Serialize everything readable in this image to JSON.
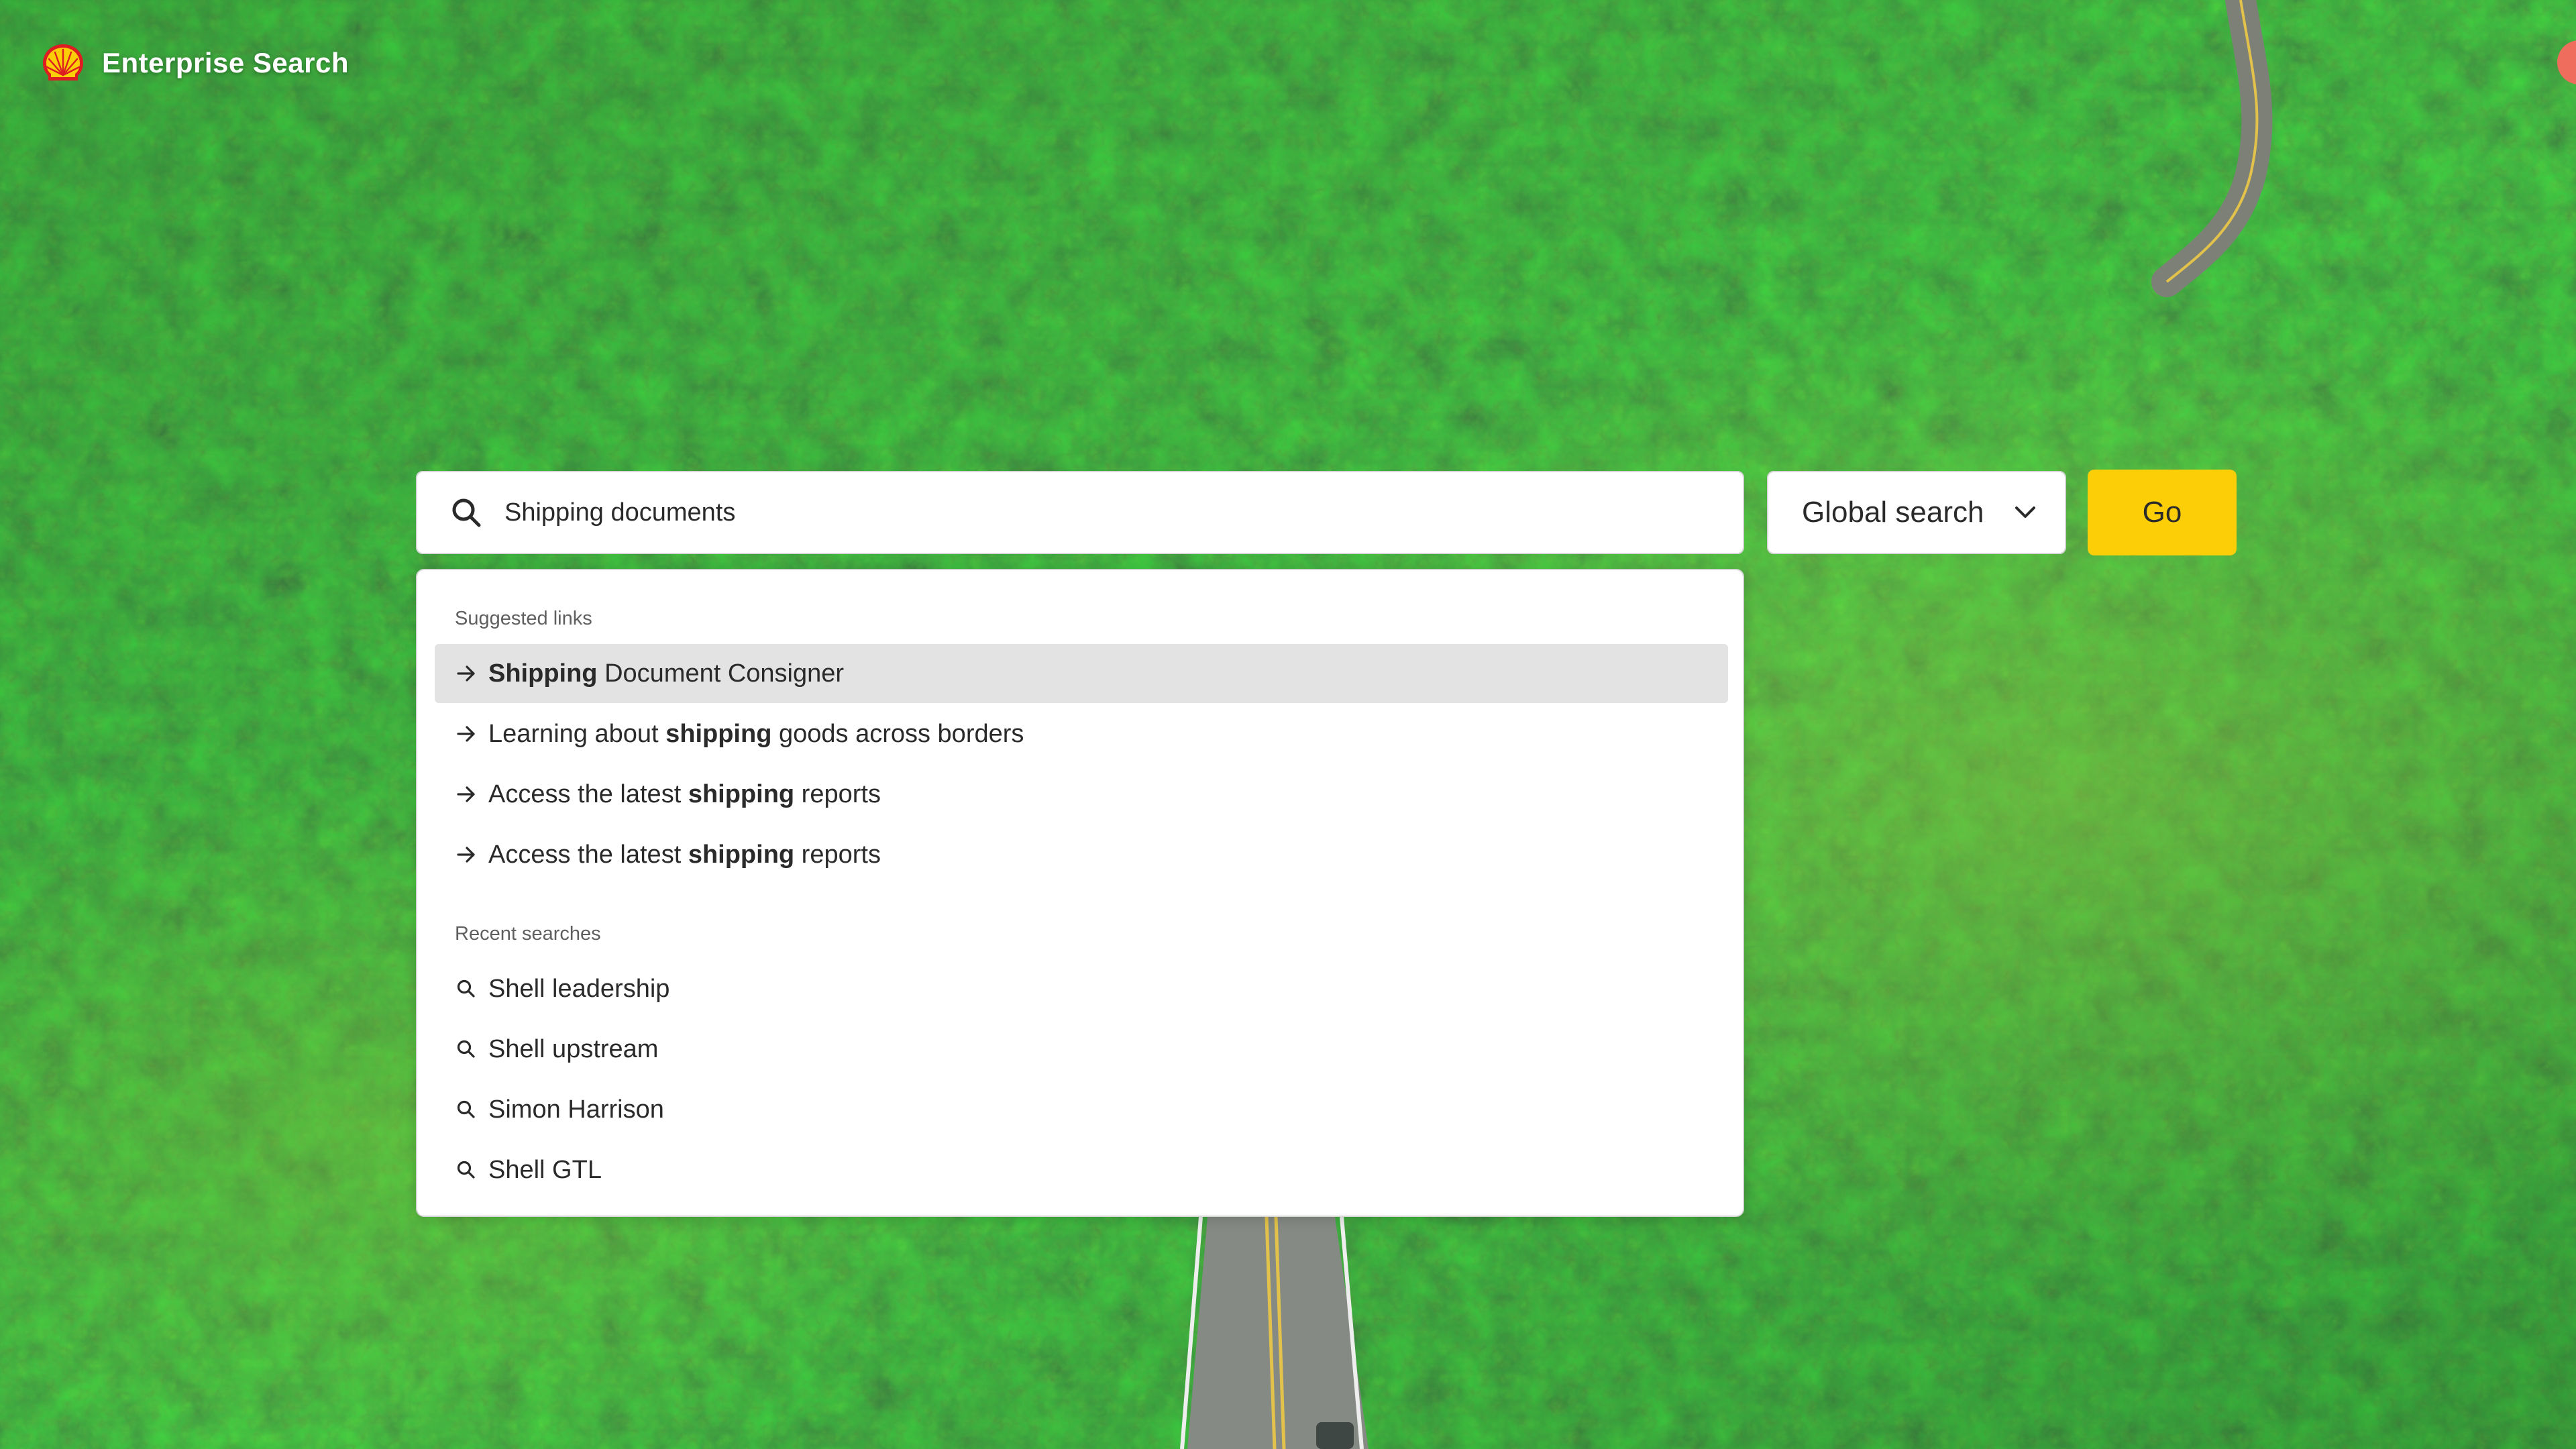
{
  "header": {
    "app_title": "Enterprise Search",
    "logo_icon": "shell-pecten-icon"
  },
  "search": {
    "value": "Shipping documents",
    "icon": "search-icon"
  },
  "scope": {
    "selected": "Global search",
    "icon": "chevron-down-icon"
  },
  "go_label": "Go",
  "dropdown": {
    "suggested_heading": "Suggested links",
    "suggested_links": [
      {
        "before": "",
        "bold": "Shipping",
        "after": " Document Consigner",
        "highlighted": true
      },
      {
        "before": "Learning about ",
        "bold": "shipping",
        "after": " goods across borders",
        "highlighted": false
      },
      {
        "before": "Access the latest ",
        "bold": "shipping",
        "after": " reports",
        "highlighted": false
      },
      {
        "before": "Access the latest ",
        "bold": "shipping",
        "after": " reports",
        "highlighted": false
      }
    ],
    "recent_heading": "Recent searches",
    "recent_searches": [
      "Shell leadership",
      "Shell upstream",
      "Simon Harrison",
      "Shell GTL"
    ]
  },
  "colors": {
    "accent_yellow": "#fbce07",
    "shell_red": "#dd1d21",
    "highlight_row": "#e3e3e3",
    "forest_dark": "#0f3a1c",
    "forest_mid": "#2f6b2c",
    "forest_light": "#6ea53a"
  }
}
